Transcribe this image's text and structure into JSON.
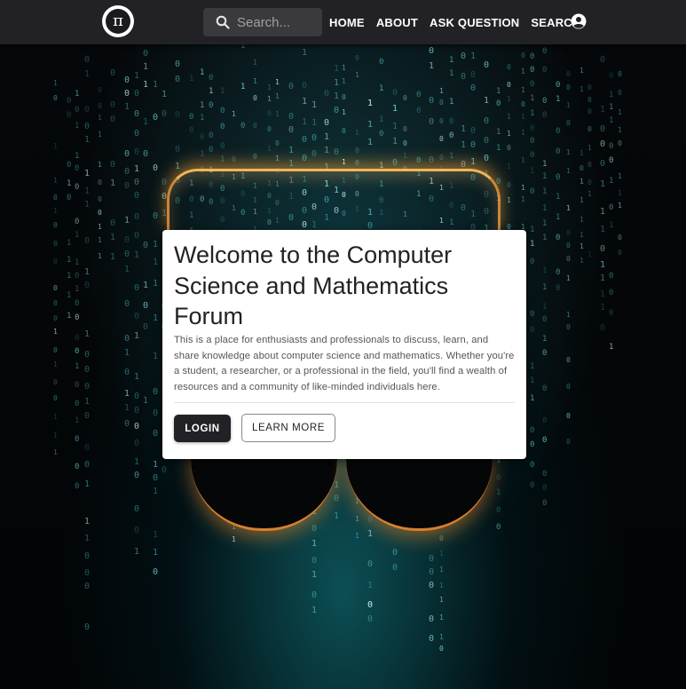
{
  "nav": {
    "logo_icon": "pi-logo-icon",
    "search_placeholder": "Search...",
    "links": [
      "HOME",
      "ABOUT",
      "ASK QUESTION",
      "SEARCH"
    ],
    "account_icon": "account-circle-icon"
  },
  "hero": {
    "title": "Welcome to the Computer Science and Mathematics Forum",
    "description": "This is a place for enthusiasts and professionals to discuss, learn, and share knowledge about computer science and mathematics. Whether you're a student, a researcher, or a professional in the field, you'll find a wealth of resources and a community of like-minded individuals here.",
    "login_label": "LOGIN",
    "learn_more_label": "LEARN MORE"
  },
  "colors": {
    "navbar": "#222226",
    "button_dark": "#212126",
    "rain_accent": "#7fe6ea",
    "glow": "#ffb050"
  }
}
